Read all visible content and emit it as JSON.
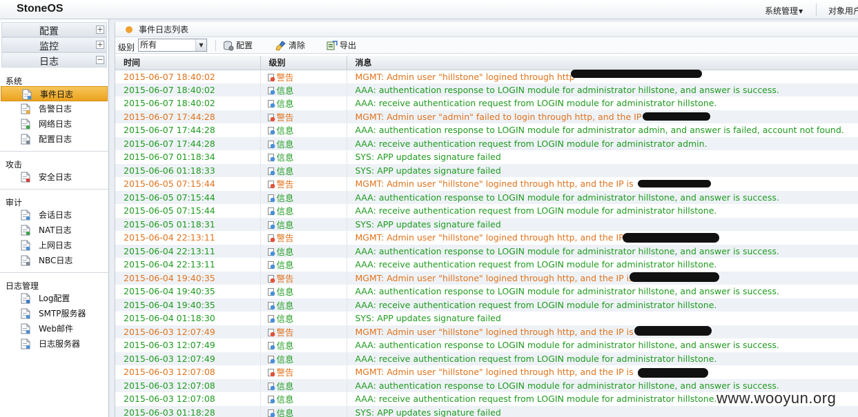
{
  "app": {
    "brand": "StoneOS"
  },
  "topnav": {
    "system_menu": "系统管理",
    "object_menu": "对象用户"
  },
  "sidebar": {
    "accordion": [
      {
        "label": "配置",
        "toggle": "+"
      },
      {
        "label": "监控",
        "toggle": "+"
      },
      {
        "label": "日志",
        "toggle": "−"
      }
    ],
    "groups": [
      {
        "title": "系统",
        "items": [
          "事件日志",
          "告警日志",
          "网络日志",
          "配置日志"
        ]
      },
      {
        "title": "攻击",
        "items": [
          "安全日志"
        ]
      },
      {
        "title": "审计",
        "items": [
          "会话日志",
          "NAT日志",
          "上网日志",
          "NBC日志"
        ]
      },
      {
        "title": "日志管理",
        "items": [
          "Log配置",
          "SMTP服务器",
          "Web邮件",
          "日志服务器"
        ]
      }
    ],
    "active_item": "事件日志"
  },
  "panel": {
    "title": "事件日志列表",
    "toolbar": {
      "level_label": "级别",
      "level_value": "所有",
      "config": "配置",
      "clear": "清除",
      "export": "导出"
    },
    "columns": [
      "时间",
      "级别",
      "消息"
    ],
    "rows": [
      {
        "time": "2015-06-07 18:40:02",
        "level": "警告",
        "type": "warn",
        "msg": "MGMT: Admin user \"hillstone\" logined through http"
      },
      {
        "time": "2015-06-07 18:40:02",
        "level": "信息",
        "type": "info",
        "msg": "AAA: authentication response to LOGIN module for administrator hillstone, and answer is success."
      },
      {
        "time": "2015-06-07 18:40:02",
        "level": "信息",
        "type": "info",
        "msg": "AAA: receive authentication request from LOGIN module for administrator hillstone."
      },
      {
        "time": "2015-06-07 17:44:28",
        "level": "警告",
        "type": "warn",
        "msg": "MGMT: Admin user \"admin\" failed to login through http, and the IP"
      },
      {
        "time": "2015-06-07 17:44:28",
        "level": "信息",
        "type": "info",
        "msg": "AAA: authentication response to LOGIN module for administrator admin, and answer is failed, account not found."
      },
      {
        "time": "2015-06-07 17:44:28",
        "level": "信息",
        "type": "info",
        "msg": "AAA: receive authentication request from LOGIN module for administrator admin."
      },
      {
        "time": "2015-06-07 01:18:34",
        "level": "信息",
        "type": "info",
        "msg": "SYS: APP updates signature failed"
      },
      {
        "time": "2015-06-06 01:18:33",
        "level": "信息",
        "type": "info",
        "msg": "SYS: APP updates signature failed"
      },
      {
        "time": "2015-06-05 07:15:44",
        "level": "警告",
        "type": "warn",
        "msg": "MGMT: Admin user \"hillstone\" logined through http, and the IP is"
      },
      {
        "time": "2015-06-05 07:15:44",
        "level": "信息",
        "type": "info",
        "msg": "AAA: authentication response to LOGIN module for administrator hillstone, and answer is success."
      },
      {
        "time": "2015-06-05 07:15:44",
        "level": "信息",
        "type": "info",
        "msg": "AAA: receive authentication request from LOGIN module for administrator hillstone."
      },
      {
        "time": "2015-06-05 01:18:31",
        "level": "信息",
        "type": "info",
        "msg": "SYS: APP updates signature failed"
      },
      {
        "time": "2015-06-04 22:13:11",
        "level": "警告",
        "type": "warn",
        "msg": "MGMT: Admin user \"hillstone\" logined through http, and the IP"
      },
      {
        "time": "2015-06-04 22:13:11",
        "level": "信息",
        "type": "info",
        "msg": "AAA: authentication response to LOGIN module for administrator hillstone, and answer is success."
      },
      {
        "time": "2015-06-04 22:13:11",
        "level": "信息",
        "type": "info",
        "msg": "AAA: receive authentication request from LOGIN module for administrator hillstone."
      },
      {
        "time": "2015-06-04 19:40:35",
        "level": "警告",
        "type": "warn",
        "msg": "MGMT: Admin user \"hillstone\" logined through http, and the IP is"
      },
      {
        "time": "2015-06-04 19:40:35",
        "level": "信息",
        "type": "info",
        "msg": "AAA: authentication response to LOGIN module for administrator hillstone, and answer is success."
      },
      {
        "time": "2015-06-04 19:40:35",
        "level": "信息",
        "type": "info",
        "msg": "AAA: receive authentication request from LOGIN module for administrator hillstone."
      },
      {
        "time": "2015-06-04 01:18:30",
        "level": "信息",
        "type": "info",
        "msg": "SYS: APP updates signature failed"
      },
      {
        "time": "2015-06-03 12:07:49",
        "level": "警告",
        "type": "warn",
        "msg": "MGMT: Admin user \"hillstone\" logined through http, and the IP is"
      },
      {
        "time": "2015-06-03 12:07:49",
        "level": "信息",
        "type": "info",
        "msg": "AAA: authentication response to LOGIN module for administrator hillstone, and answer is success."
      },
      {
        "time": "2015-06-03 12:07:49",
        "level": "信息",
        "type": "info",
        "msg": "AAA: receive authentication request from LOGIN module for administrator hillstone."
      },
      {
        "time": "2015-06-03 12:07:08",
        "level": "警告",
        "type": "warn",
        "msg": "MGMT: Admin user \"hillstone\" logined through http, and the IP is"
      },
      {
        "time": "2015-06-03 12:07:08",
        "level": "信息",
        "type": "info",
        "msg": "AAA: authentication response to LOGIN module for administrator hillstone, and answer is success."
      },
      {
        "time": "2015-06-03 12:07:08",
        "level": "信息",
        "type": "info",
        "msg": "AAA: receive authentication request from LOGIN module for administrator hillstone."
      },
      {
        "time": "2015-06-03 01:18:28",
        "level": "信息",
        "type": "info",
        "msg": "SYS: APP updates signature failed"
      }
    ]
  },
  "watermark": "www.wooyun.org",
  "colors": {
    "warn": "#e0731c",
    "info": "#1f9a1f",
    "active": "#eba21f"
  }
}
